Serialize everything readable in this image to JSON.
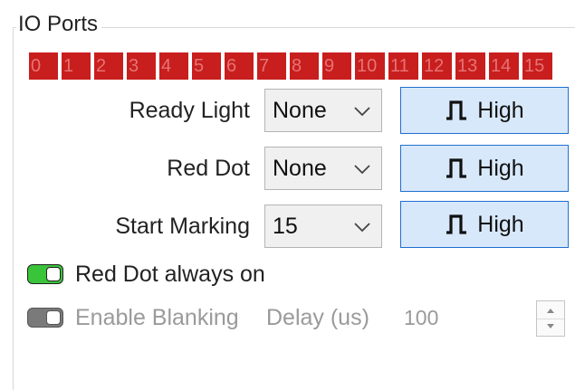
{
  "group": {
    "title": "IO Ports"
  },
  "ports": [
    "0",
    "1",
    "2",
    "3",
    "4",
    "5",
    "6",
    "7",
    "8",
    "9",
    "10",
    "11",
    "12",
    "13",
    "14",
    "15"
  ],
  "rows": [
    {
      "label": "Ready Light",
      "value": "None",
      "button": "High"
    },
    {
      "label": "Red Dot",
      "value": "None",
      "button": "High"
    },
    {
      "label": "Start Marking",
      "value": "15",
      "button": "High"
    }
  ],
  "options": {
    "red_dot_always_on": {
      "label": "Red Dot always on",
      "enabled": true
    },
    "enable_blanking": {
      "label": "Enable Blanking",
      "enabled": false
    }
  },
  "delay": {
    "label": "Delay (us)",
    "value": "100"
  },
  "colors": {
    "port_active": "#c81e1e",
    "toggle_on": "#3ac43a",
    "toggle_off": "#7a7a7a",
    "button_bg": "#d8e8fb",
    "button_border": "#1f6fcf"
  },
  "icons": {
    "combo": "chevron-down-icon",
    "pulse": "pulse-icon",
    "spin_up": "spin-up-icon",
    "spin_down": "spin-down-icon"
  }
}
